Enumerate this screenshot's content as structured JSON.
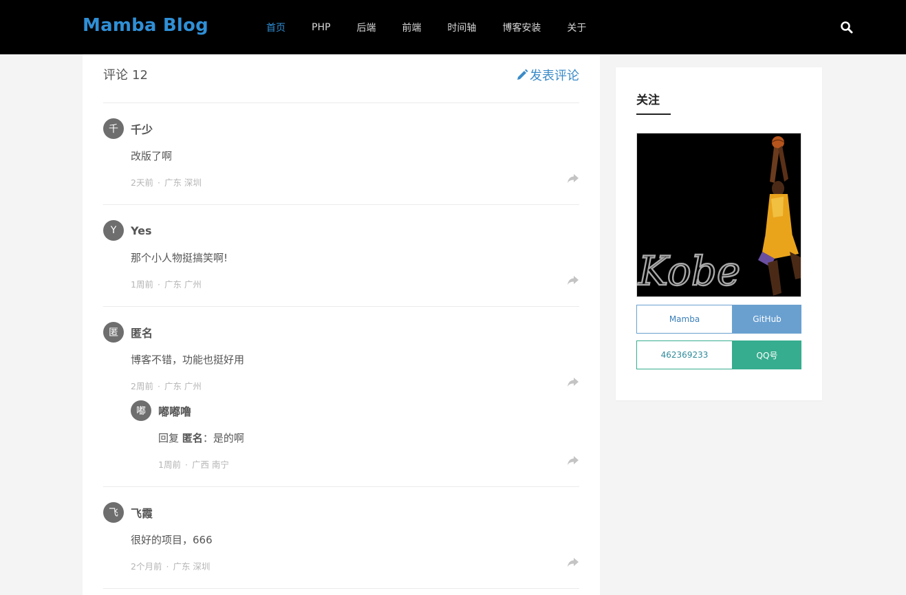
{
  "header": {
    "logo": "Mamba Blog",
    "nav": [
      {
        "label": "首页",
        "active": true
      },
      {
        "label": "PHP",
        "active": false
      },
      {
        "label": "后端",
        "active": false
      },
      {
        "label": "前端",
        "active": false
      },
      {
        "label": "时间轴",
        "active": false
      },
      {
        "label": "博客安装",
        "active": false
      },
      {
        "label": "关于",
        "active": false
      }
    ],
    "search_icon": "search-icon"
  },
  "comments": {
    "title": "评论",
    "count": "12",
    "post_label": "发表评论",
    "items": [
      {
        "avatar": "千",
        "name": "千少",
        "text": "改版了啊",
        "time": "2天前",
        "location": "广东 深圳"
      },
      {
        "avatar": "Y",
        "name": "Yes",
        "text": "那个小人物挺搞笑啊!",
        "time": "1周前",
        "location": "广东 广州"
      },
      {
        "avatar": "匿",
        "name": "匿名",
        "text": "博客不错，功能也挺好用",
        "time": "2周前",
        "location": "广东 广州",
        "reply": {
          "avatar": "嘟",
          "name": "嘟嘟噜",
          "prefix": "回复",
          "target": "匿名",
          "text": "：是的啊",
          "time": "1周前",
          "location": "广西 南宁"
        }
      },
      {
        "avatar": "飞",
        "name": "飞霞",
        "text": "很好的项目，666",
        "time": "2个月前",
        "location": "广东 深圳"
      }
    ]
  },
  "sidebar": {
    "title": "关注",
    "image_text": "Kobe",
    "links": [
      {
        "left": "Mamba",
        "right": "GitHub",
        "color": "#6aa0d0",
        "text_color": "#3a7fb8"
      },
      {
        "left": "462369233",
        "right": "QQ号",
        "color": "#35ad8e",
        "text_color": "#2f8a9a"
      }
    ]
  }
}
